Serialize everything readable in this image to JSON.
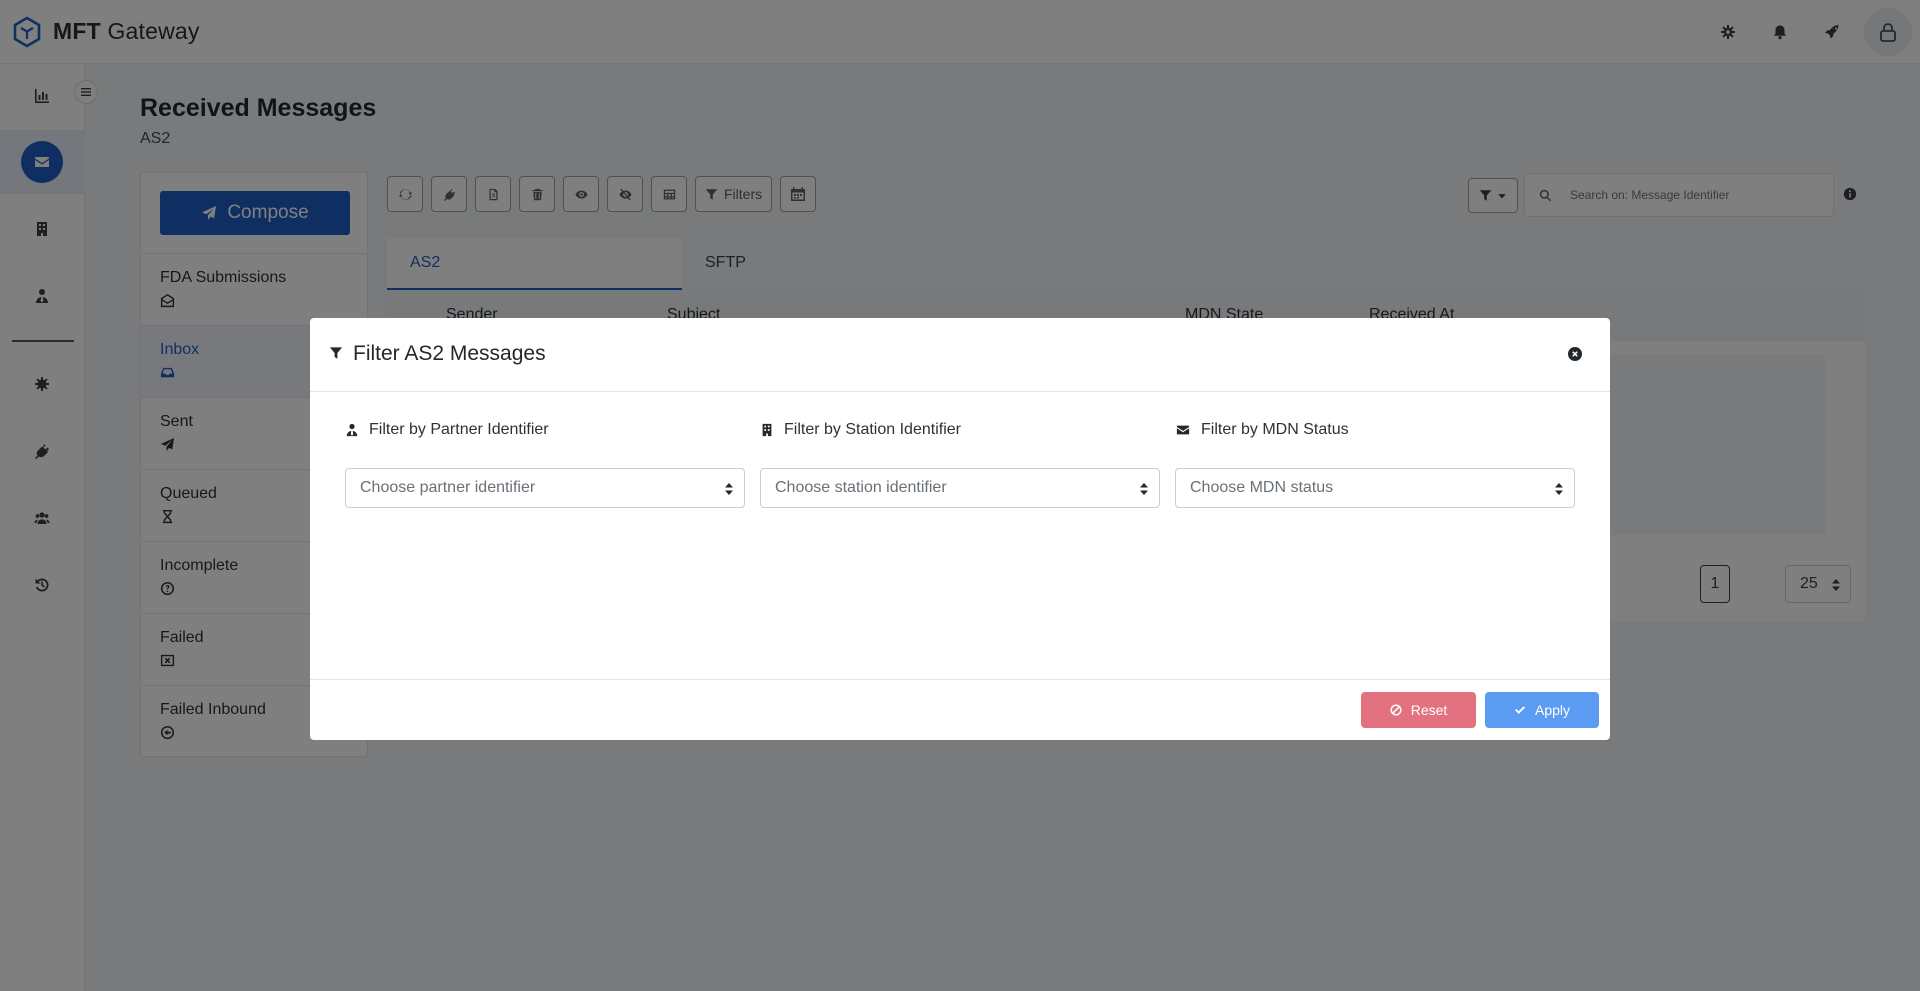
{
  "brand": {
    "name_bold": "MFT",
    "name_rest": " Gateway"
  },
  "page": {
    "title": "Received Messages",
    "subtitle": "AS2"
  },
  "compose_label": "Compose",
  "folders": [
    {
      "label": "FDA Submissions",
      "icon": "envelope-open-icon"
    },
    {
      "label": "Inbox",
      "icon": "inbox-icon"
    },
    {
      "label": "Sent",
      "icon": "paper-plane-icon"
    },
    {
      "label": "Queued",
      "icon": "hourglass-icon"
    },
    {
      "label": "Incomplete",
      "icon": "question-circle-icon"
    },
    {
      "label": "Failed",
      "icon": "x-square-icon"
    },
    {
      "label": "Failed Inbound",
      "icon": "arrow-circle-icon"
    }
  ],
  "toolbar": {
    "filters_label": "Filters"
  },
  "search": {
    "placeholder": "Search on: Message Identifier"
  },
  "tabs": [
    "AS2",
    "SFTP"
  ],
  "table": {
    "columns": [
      "Sender",
      "Subject",
      "MDN State",
      "Received At"
    ]
  },
  "pager": {
    "page": "1",
    "page_size": "25"
  },
  "modal": {
    "title": "Filter AS2 Messages",
    "filters": [
      {
        "label": "Filter by Partner Identifier",
        "placeholder": "Choose partner identifier",
        "icon": "user-tie-icon"
      },
      {
        "label": "Filter by Station Identifier",
        "placeholder": "Choose station identifier",
        "icon": "building-icon"
      },
      {
        "label": "Filter by MDN Status",
        "placeholder": "Choose MDN status",
        "icon": "envelope-icon"
      }
    ],
    "reset_label": "Reset",
    "apply_label": "Apply"
  },
  "colors": {
    "accent": "#1f5fc4",
    "reset": "#e2727f",
    "apply": "#5c9bf2"
  }
}
